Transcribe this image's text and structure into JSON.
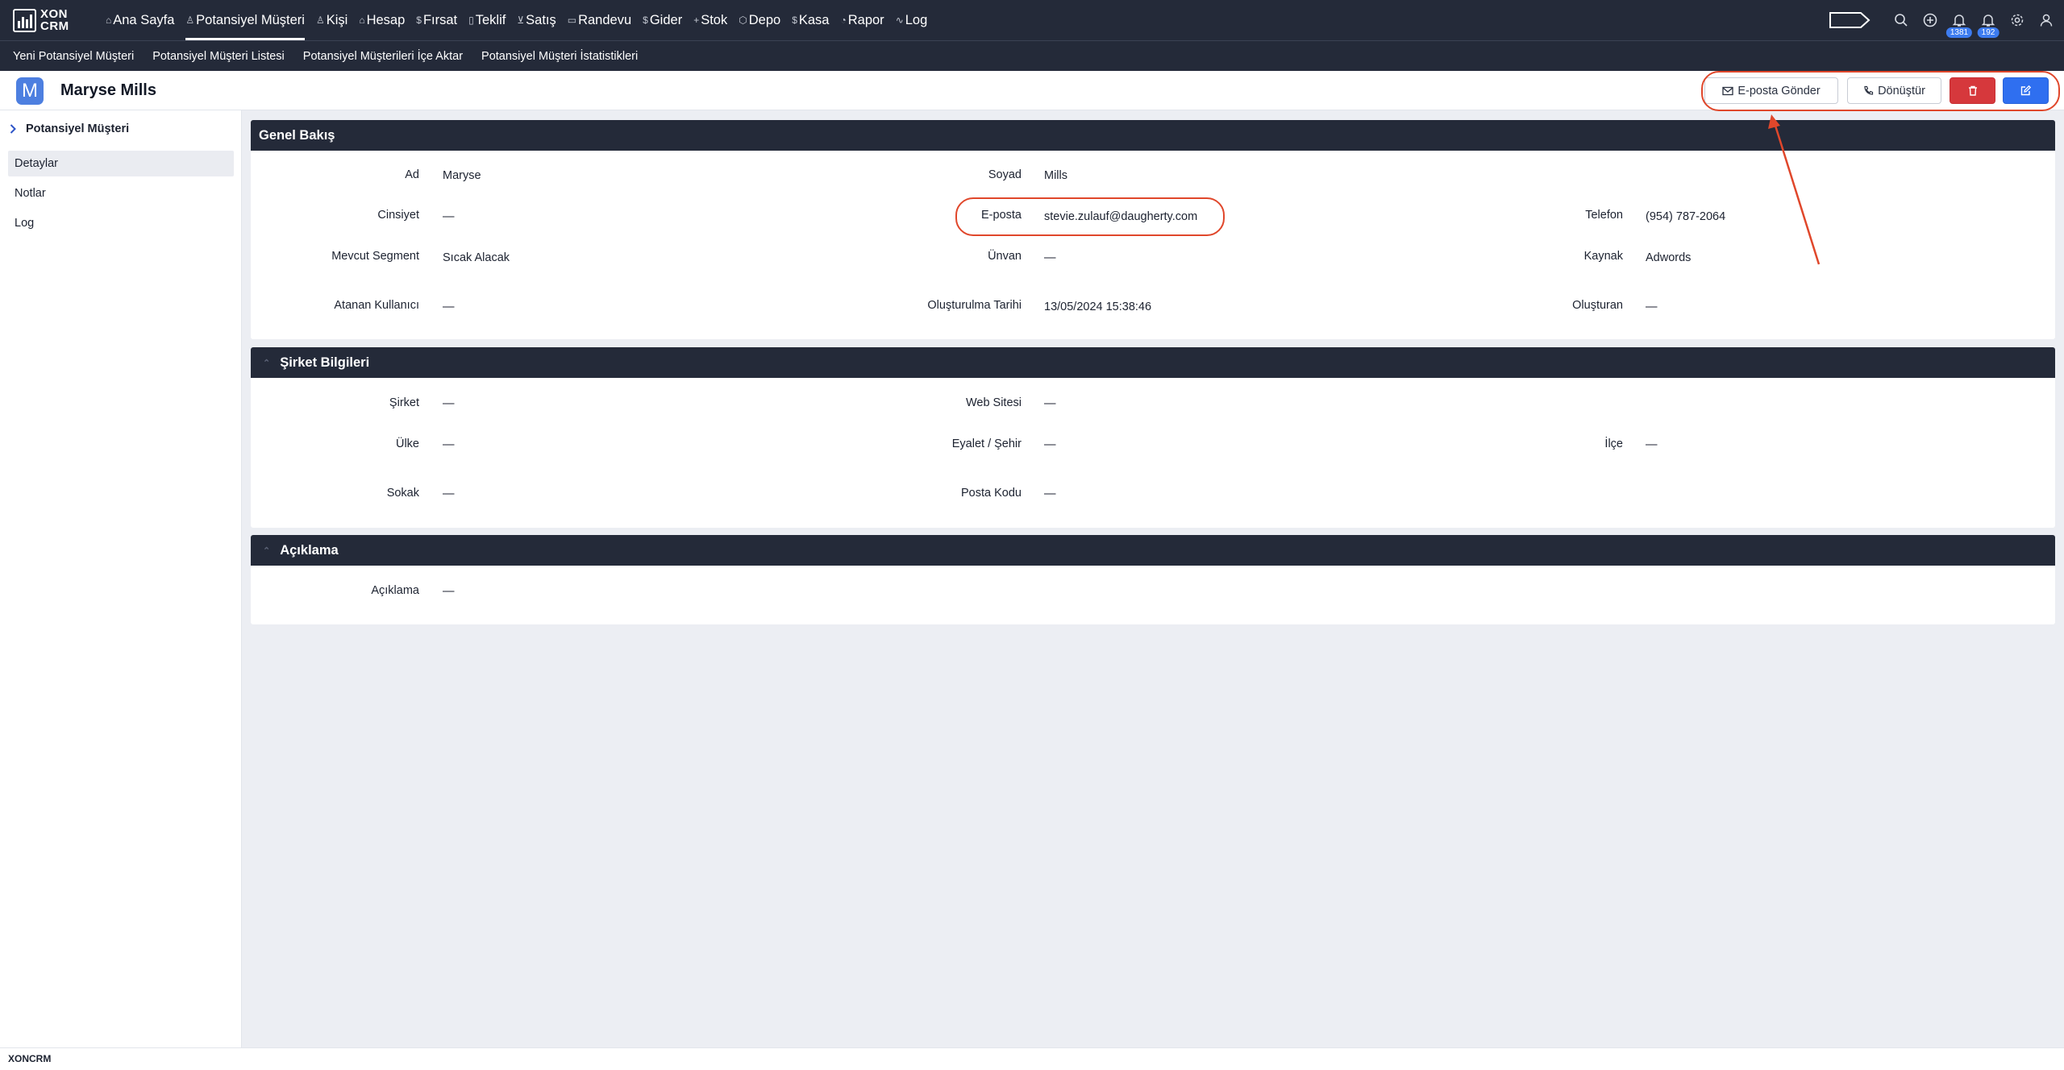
{
  "app": {
    "logo_line1": "XON",
    "logo_line2": "CRM",
    "footer_brand": "XONCRM"
  },
  "nav": {
    "items": [
      {
        "label": "Ana Sayfa",
        "icon": "home-icon"
      },
      {
        "label": "Potansiyel Müşteri",
        "icon": "user-icon"
      },
      {
        "label": "Kişi",
        "icon": "users-icon"
      },
      {
        "label": "Hesap",
        "icon": "building-icon"
      },
      {
        "label": "Fırsat",
        "icon": "dollar-icon"
      },
      {
        "label": "Teklif",
        "icon": "document-icon"
      },
      {
        "label": "Satış",
        "icon": "cart-icon"
      },
      {
        "label": "Randevu",
        "icon": "calendar-icon"
      },
      {
        "label": "Gider",
        "icon": "dollar-icon"
      },
      {
        "label": "Stok",
        "icon": "plus-icon"
      },
      {
        "label": "Depo",
        "icon": "box-icon"
      },
      {
        "label": "Kasa",
        "icon": "dollar-icon"
      },
      {
        "label": "Rapor",
        "icon": "pie-icon"
      },
      {
        "label": "Log",
        "icon": "activity-icon"
      }
    ],
    "active_index": 1,
    "notif_count_1": "1381",
    "notif_count_2": "192"
  },
  "subnav": {
    "items": [
      "Yeni Potansiyel Müşteri",
      "Potansiyel Müşteri Listesi",
      "Potansiyel Müşterileri İçe Aktar",
      "Potansiyel Müşteri İstatistikleri"
    ]
  },
  "header": {
    "avatar_letter": "M",
    "title": "Maryse Mills",
    "send_email_label": "E-posta Gönder",
    "convert_label": "Dönüştür"
  },
  "sidebar": {
    "title": "Potansiyel Müşteri",
    "items": [
      "Detaylar",
      "Notlar",
      "Log"
    ],
    "active_index": 0
  },
  "overview": {
    "title": "Genel Bakış",
    "fields": {
      "first_name": {
        "label": "Ad",
        "value": "Maryse"
      },
      "last_name": {
        "label": "Soyad",
        "value": "Mills"
      },
      "gender": {
        "label": "Cinsiyet",
        "value": "—"
      },
      "email": {
        "label": "E-posta",
        "value": "stevie.zulauf@daugherty.com"
      },
      "phone": {
        "label": "Telefon",
        "value": "(954) 787-2064"
      },
      "segment": {
        "label": "Mevcut Segment",
        "value": "Sıcak Alacak"
      },
      "title": {
        "label": "Ünvan",
        "value": "—"
      },
      "source": {
        "label": "Kaynak",
        "value": "Adwords"
      },
      "assigned_user": {
        "label": "Atanan Kullanıcı",
        "value": "—"
      },
      "created_at": {
        "label": "Oluşturulma Tarihi",
        "value": "13/05/2024 15:38:46"
      },
      "created_by": {
        "label": "Oluşturan",
        "value": "—"
      }
    }
  },
  "company": {
    "title": "Şirket Bilgileri",
    "fields": {
      "company": {
        "label": "Şirket",
        "value": "—"
      },
      "website": {
        "label": "Web Sitesi",
        "value": "—"
      },
      "country": {
        "label": "Ülke",
        "value": "—"
      },
      "state_city": {
        "label": "Eyalet / Şehir",
        "value": "—"
      },
      "district": {
        "label": "İlçe",
        "value": "—"
      },
      "street": {
        "label": "Sokak",
        "value": "—"
      },
      "postal_code": {
        "label": "Posta Kodu",
        "value": "—"
      }
    }
  },
  "description": {
    "title": "Açıklama",
    "fields": {
      "description": {
        "label": "Açıklama",
        "value": "—"
      }
    }
  },
  "colors": {
    "nav_bg": "#242a39",
    "accent_blue": "#2f6ff0",
    "danger_red": "#d6383c",
    "annotation_red": "#e0472b"
  }
}
